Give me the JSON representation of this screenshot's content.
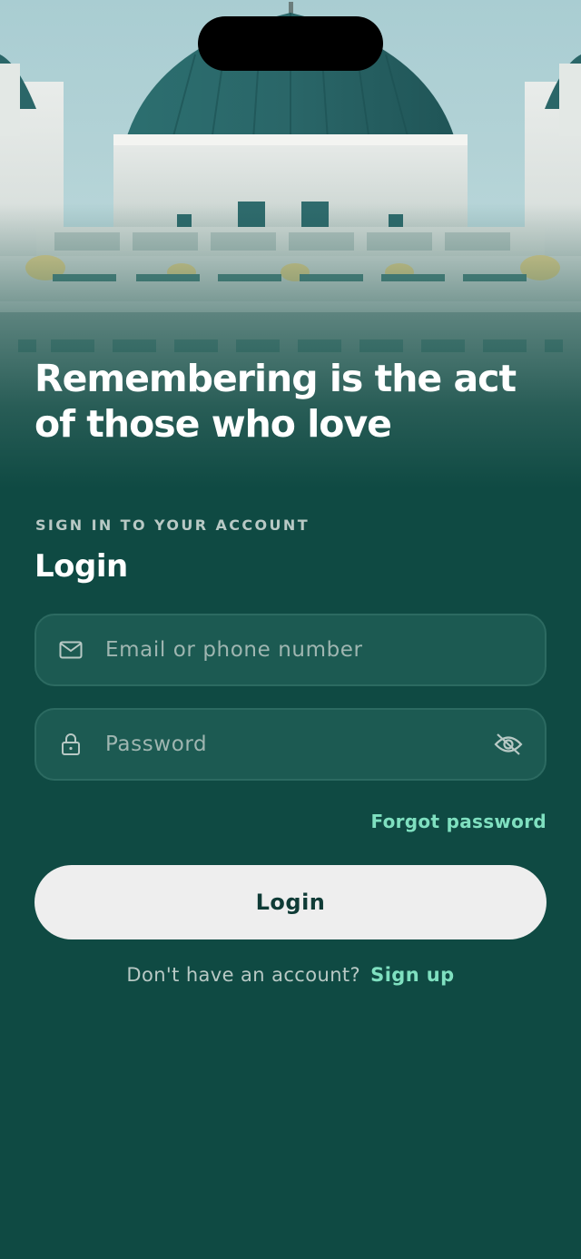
{
  "hero": {
    "headline": "Remembering is the act of those who love"
  },
  "login": {
    "eyebrow": "SIGN IN TO YOUR ACCOUNT",
    "title": "Login",
    "email_placeholder": "Email or phone number",
    "password_placeholder": "Password",
    "forgot_label": "Forgot password",
    "button_label": "Login",
    "signup_prompt": "Don't have an account?",
    "signup_label": "Sign up"
  },
  "icons": {
    "email": "mail-icon",
    "password": "lock-icon",
    "toggle_visibility": "eye-off-icon"
  },
  "colors": {
    "background": "#0f4a43",
    "field_background": "#1c5a52",
    "field_border": "#2c6a61",
    "accent": "#7fe0c0",
    "button_background": "#eeeeee",
    "button_text": "#0f3b36",
    "muted_text": "#b8c9c5"
  }
}
